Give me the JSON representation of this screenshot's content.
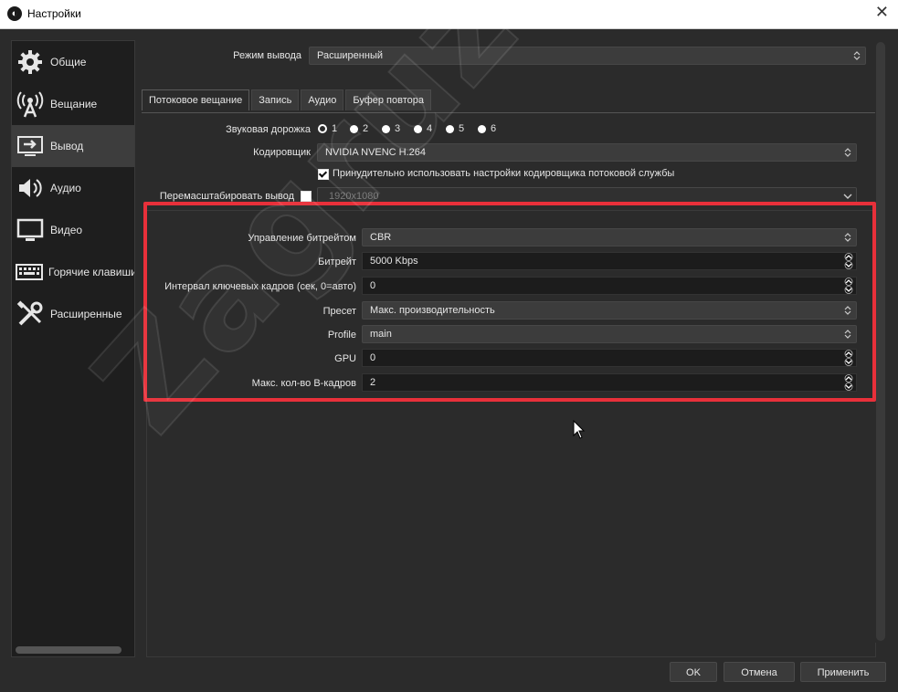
{
  "window": {
    "title": "Настройки"
  },
  "sidebar": {
    "items": [
      {
        "label": "Общие",
        "icon": "gear-icon"
      },
      {
        "label": "Вещание",
        "icon": "broadcast-antenna-icon"
      },
      {
        "label": "Вывод",
        "icon": "monitor-output-icon",
        "selected": true
      },
      {
        "label": "Аудио",
        "icon": "speaker-icon"
      },
      {
        "label": "Видео",
        "icon": "monitor-icon"
      },
      {
        "label": "Горячие клавиши",
        "icon": "keyboard-icon"
      },
      {
        "label": "Расширенные",
        "icon": "tools-icon"
      }
    ]
  },
  "output_mode": {
    "label": "Режим вывода",
    "value": "Расширенный"
  },
  "tabs": [
    "Потоковое вещание",
    "Запись",
    "Аудио",
    "Буфер повтора"
  ],
  "audio_track": {
    "label": "Звуковая дорожка",
    "options": [
      "1",
      "2",
      "3",
      "4",
      "5",
      "6"
    ],
    "selected": "1"
  },
  "encoder": {
    "label": "Кодировщик",
    "value": "NVIDIA NVENC H.264"
  },
  "enforce_settings": {
    "label": "Принудительно использовать настройки кодировщика потоковой службы",
    "checked": true
  },
  "rescale": {
    "label": "Перемасштабировать вывод",
    "checked": false,
    "value": "1920x1080"
  },
  "encoder_settings": {
    "rate_control": {
      "label": "Управление битрейтом",
      "value": "CBR"
    },
    "bitrate": {
      "label": "Битрейт",
      "value": "5000 Kbps"
    },
    "keyframe_interval": {
      "label": "Интервал ключевых кадров (сек, 0=авто)",
      "value": "0"
    },
    "preset": {
      "label": "Пресет",
      "value": "Макс. производительность"
    },
    "profile": {
      "label": "Profile",
      "value": "main"
    },
    "gpu": {
      "label": "GPU",
      "value": "0"
    },
    "bframes": {
      "label": "Макс. кол-во B-кадров",
      "value": "2"
    }
  },
  "buttons": {
    "ok": "OK",
    "cancel": "Отмена",
    "apply": "Применить"
  },
  "watermark": "Zagruzi.Top",
  "colors": {
    "highlight": "#e8303a",
    "background": "#2b2b2b",
    "sidebar": "#1e1e1e"
  }
}
